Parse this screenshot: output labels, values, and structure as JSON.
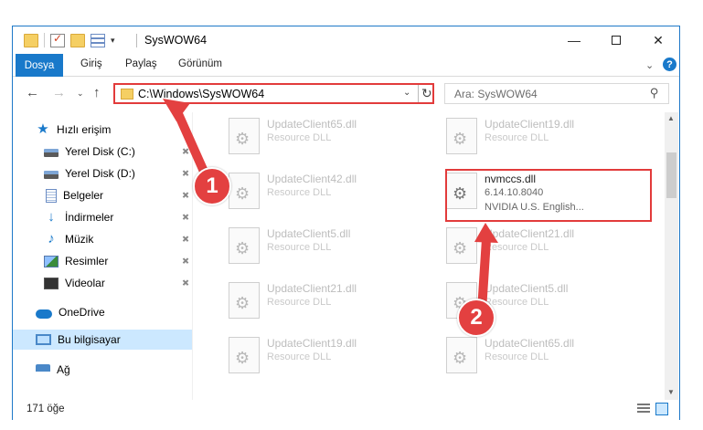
{
  "window": {
    "title": "SysWOW64",
    "qat_dropdown": "▾",
    "controls": {
      "minimize": "—",
      "maximize": "",
      "close": "✕"
    }
  },
  "ribbon": {
    "tabs": [
      "Dosya",
      "Giriş",
      "Paylaş",
      "Görünüm"
    ],
    "expand": "⌄",
    "help": "?"
  },
  "nav": {
    "back": "←",
    "forward": "→",
    "recent": "⌄",
    "up": "↑",
    "address": "C:\\Windows\\SysWOW64",
    "address_dropdown": "⌄",
    "refresh": "↻",
    "search_placeholder": "Ara: SysWOW64",
    "search_icon": "⚲"
  },
  "sidebar": {
    "items": [
      {
        "label": "Hızlı erişim",
        "icon": "star-icon",
        "pinned": false
      },
      {
        "label": "Yerel Disk (C:)",
        "icon": "disk-icon",
        "pinned": true
      },
      {
        "label": "Yerel Disk (D:)",
        "icon": "disk-icon",
        "pinned": true
      },
      {
        "label": "Belgeler",
        "icon": "document-icon",
        "pinned": true
      },
      {
        "label": "İndirmeler",
        "icon": "download-icon",
        "pinned": true
      },
      {
        "label": "Müzik",
        "icon": "music-icon",
        "pinned": true
      },
      {
        "label": "Resimler",
        "icon": "pictures-icon",
        "pinned": true
      },
      {
        "label": "Videolar",
        "icon": "videos-icon",
        "pinned": true
      },
      {
        "label": "OneDrive",
        "icon": "cloud-icon",
        "pinned": false
      },
      {
        "label": "Bu bilgisayar",
        "icon": "computer-icon",
        "pinned": false,
        "selected": true
      },
      {
        "label": "Ağ",
        "icon": "network-icon",
        "pinned": false
      }
    ],
    "pin_glyph": "📌"
  },
  "files": {
    "left_column": [
      {
        "name": "UpdateClient65.dll",
        "desc": "Resource DLL"
      },
      {
        "name": "UpdateClient42.dll",
        "desc": "Resource DLL"
      },
      {
        "name": "UpdateClient5.dll",
        "desc": "Resource DLL"
      },
      {
        "name": "UpdateClient21.dll",
        "desc": "Resource DLL"
      },
      {
        "name": "UpdateClient19.dll",
        "desc": "Resource DLL"
      }
    ],
    "right_column": [
      {
        "name": "UpdateClient19.dll",
        "desc": "Resource DLL"
      },
      {
        "name": "nvmccs.dll",
        "desc": "6.14.10.8040",
        "desc2": "NVIDIA U.S. English...",
        "highlight": true
      },
      {
        "name": "UpdateClient21.dll",
        "desc": "Resource DLL"
      },
      {
        "name": "UpdateClient5.dll",
        "desc": "Resource DLL"
      },
      {
        "name": "UpdateClient65.dll",
        "desc": "Resource DLL"
      }
    ],
    "gear_glyph": "⚙"
  },
  "status": {
    "item_count": "171 öğe"
  },
  "annotations": {
    "badge_1": "1",
    "badge_2": "2",
    "accent": "#e34040"
  },
  "colors": {
    "accent": "#1979ca",
    "selection": "#cce8ff",
    "highlight_border": "#e23b3b"
  }
}
